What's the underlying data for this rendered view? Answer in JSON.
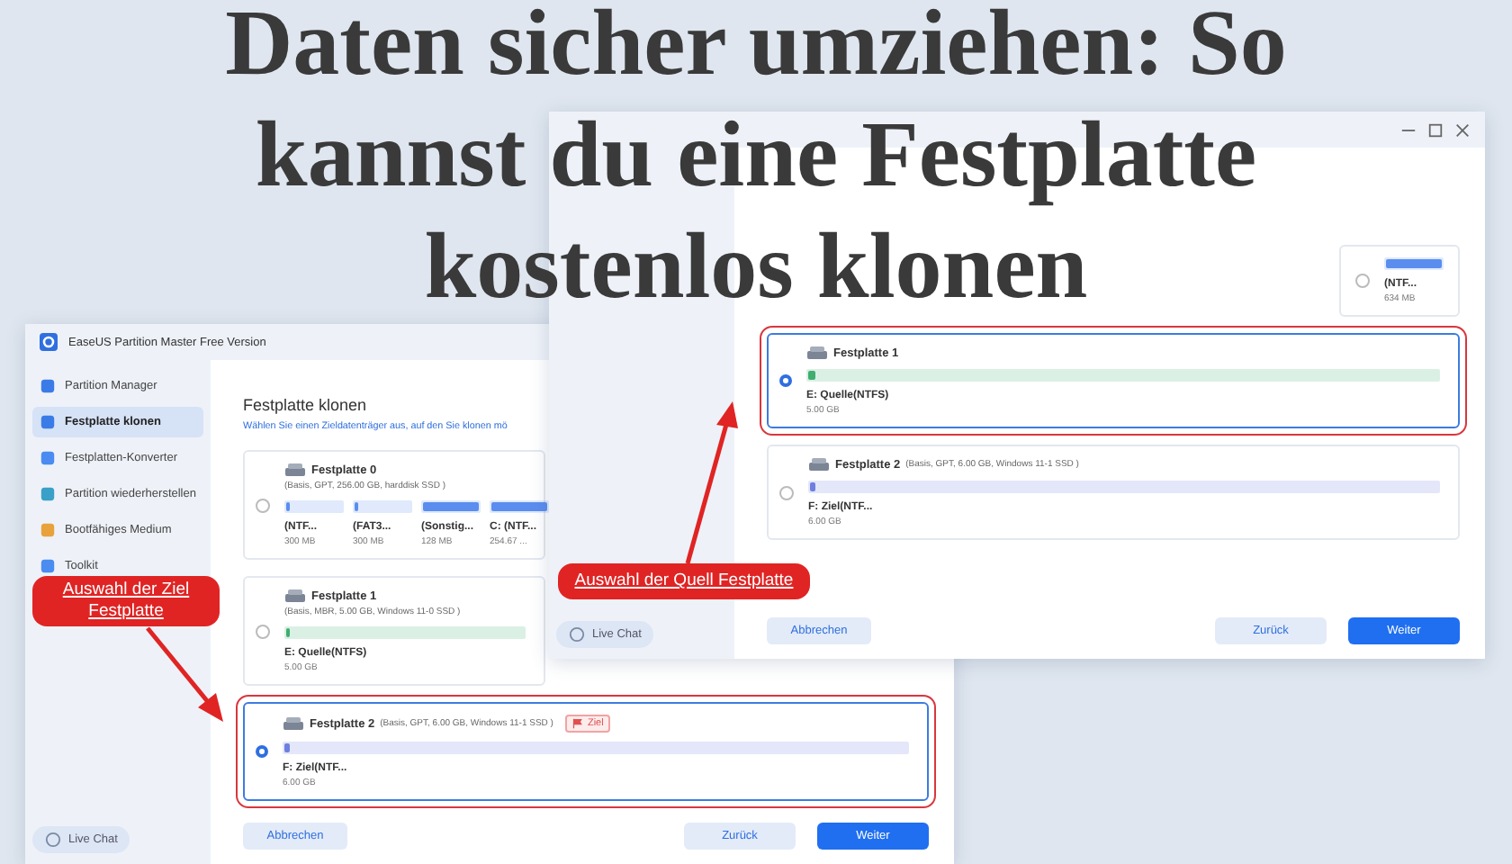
{
  "headline": "Daten sicher umziehen: So kannst du eine Festplatte kostenlos klonen",
  "windows": [
    {
      "kind": "front",
      "app_title": "EaseUS Partition Master Free Version",
      "sidebar": [
        {
          "label": "Partition Manager",
          "selected": false
        },
        {
          "label": "Festplatte klonen",
          "selected": true
        },
        {
          "label": "Festplatten-Konverter",
          "selected": false
        },
        {
          "label": "Partition wiederherstellen",
          "selected": false
        },
        {
          "label": "Bootfähiges Medium",
          "selected": false
        },
        {
          "label": "Toolkit",
          "selected": false
        }
      ],
      "live_chat": "Live Chat",
      "heading": "Festplatte klonen",
      "subheading": "Wählen Sie einen Zieldatenträger aus, auf den Sie klonen mö",
      "disks": [
        {
          "name": "Festplatte 0",
          "details": "(Basis, GPT, 256.00 GB, harddisk SSD )",
          "selected": false,
          "partitions": [
            {
              "label": "(NTF...",
              "size": "300 MB",
              "level": 0.05,
              "color": "#5b8def"
            },
            {
              "label": "(FAT3...",
              "size": "300 MB",
              "level": 0.05,
              "color": "#5b8def"
            },
            {
              "label": "(Sonstig...",
              "size": "128 MB",
              "level": 1,
              "color": "#5b8def"
            },
            {
              "label": "C: (NTF...",
              "size": "254.67 ...",
              "level": 1,
              "color": "#5b8def"
            }
          ]
        },
        {
          "name": "Festplatte 1",
          "details": "(Basis, MBR, 5.00 GB, Windows 11-0 SSD )",
          "selected": false,
          "partitions": [
            {
              "label": "E: Quelle(NTFS)",
              "size": "5.00 GB",
              "level": 0.01,
              "color": "#3fae6f"
            }
          ]
        },
        {
          "name": "Festplatte 2",
          "details": "(Basis, GPT, 6.00 GB, Windows 11-1 SSD )",
          "badge": "Ziel",
          "selected": true,
          "partitions": [
            {
              "label": "F: Ziel(NTF...",
              "size": "6.00 GB",
              "level": 0.01,
              "color": "#6f7fe0"
            }
          ]
        }
      ],
      "buttons": [
        {
          "label": "Abbrechen",
          "kind": "secondary"
        },
        {
          "label": "Zurück",
          "kind": "secondary"
        },
        {
          "label": "Weiter",
          "kind": "primary"
        }
      ]
    },
    {
      "kind": "back",
      "live_chat": "Live Chat",
      "disks": [
        {
          "selected": false,
          "partitions": [
            {
              "label": "(NTF...",
              "size": "634 MB",
              "level": 1,
              "color": "#5b8def"
            }
          ]
        },
        {
          "name": "Festplatte 1",
          "selected": true,
          "partitions": [
            {
              "label": "E: Quelle(NTFS)",
              "size": "5.00 GB",
              "level": 0.01,
              "color": "#3fae6f"
            }
          ]
        },
        {
          "name": "Festplatte 2",
          "details": "(Basis, GPT, 6.00 GB, Windows 11-1 SSD )",
          "selected": false,
          "partitions": [
            {
              "label": "F: Ziel(NTF...",
              "size": "6.00 GB",
              "level": 0.01,
              "color": "#6f7fe0"
            }
          ]
        }
      ],
      "buttons": [
        {
          "label": "Abbrechen",
          "kind": "secondary"
        },
        {
          "label": "Zurück",
          "kind": "secondary"
        },
        {
          "label": "Weiter",
          "kind": "primary"
        }
      ]
    }
  ],
  "callouts": [
    {
      "text": "Auswahl der Ziel Festplatte",
      "kind": "target"
    },
    {
      "text": "Auswahl der Quell Festplatte",
      "kind": "source"
    }
  ]
}
